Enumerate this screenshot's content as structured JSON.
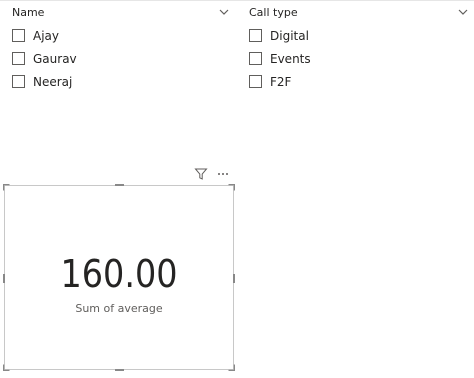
{
  "slicers": [
    {
      "title": "Name",
      "items": [
        {
          "label": "Ajay"
        },
        {
          "label": "Gaurav"
        },
        {
          "label": "Neeraj"
        }
      ]
    },
    {
      "title": "Call type",
      "items": [
        {
          "label": "Digital"
        },
        {
          "label": "Events"
        },
        {
          "label": "F2F"
        }
      ]
    }
  ],
  "card": {
    "value": "160.00",
    "label": "Sum of average"
  },
  "icons": {
    "chevron": "chevron-down-icon",
    "filter": "filter-icon",
    "more": "more-options-icon"
  },
  "colors": {
    "text": "#252423",
    "subtext": "#605e5c",
    "border": "#c8c8c8"
  }
}
